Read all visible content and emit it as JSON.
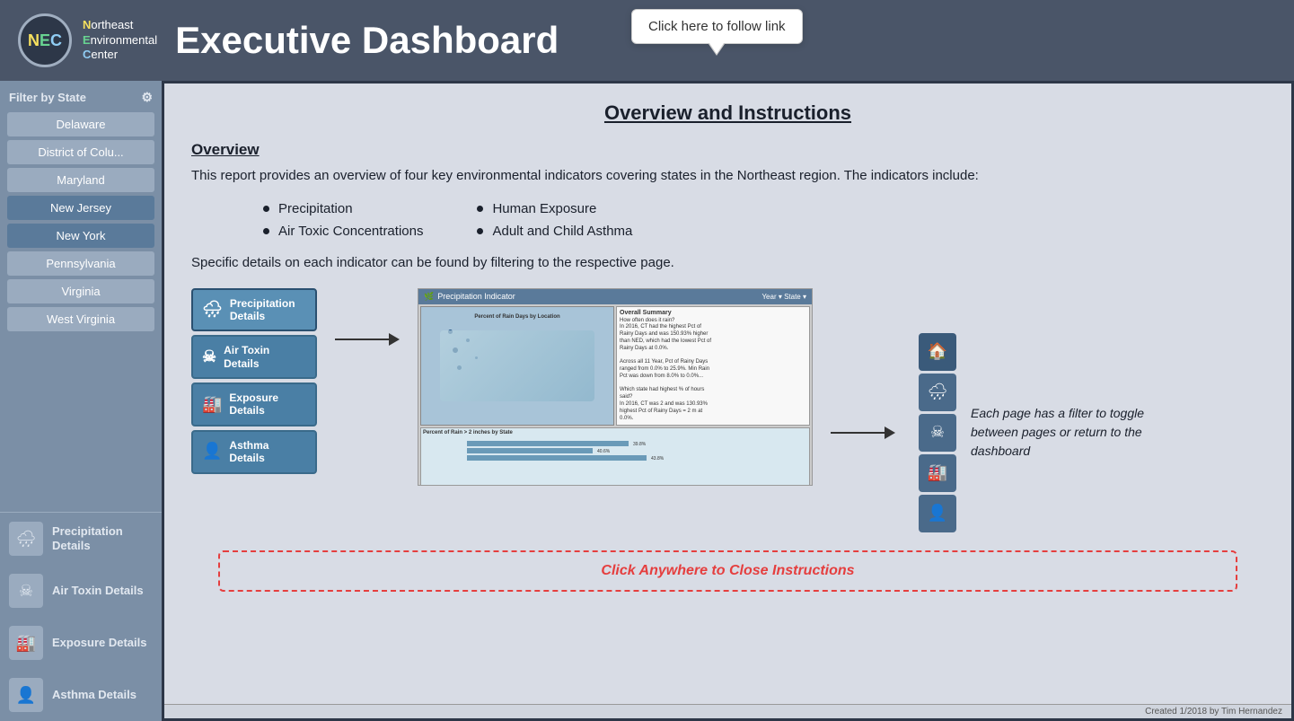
{
  "header": {
    "logo_letters": "NEC",
    "org_line1": "Northeast",
    "org_line2": "Environmental",
    "org_line3": "Center",
    "title": "Executive Dashboard"
  },
  "tooltip": {
    "label": "Click here to follow link"
  },
  "sidebar": {
    "filter_label": "Filter by State",
    "states": [
      {
        "label": "Delaware"
      },
      {
        "label": "District of Colu..."
      },
      {
        "label": "Maryland"
      },
      {
        "label": "New Jersey"
      },
      {
        "label": "New York"
      },
      {
        "label": "Pennsylvania"
      },
      {
        "label": "Virginia"
      },
      {
        "label": "West Virginia"
      }
    ],
    "nav_items": [
      {
        "label": "Precipitation Details",
        "icon": "🌧"
      },
      {
        "label": "Air Toxin Details",
        "icon": "☠"
      },
      {
        "label": "Exposure Details",
        "icon": "🏭"
      },
      {
        "label": "Asthma Details",
        "icon": "👤"
      }
    ]
  },
  "instructions": {
    "title": "Overview and Instructions",
    "overview_heading": "Overview",
    "overview_text": "This report provides an overview of four key environmental indicators covering states in the Northeast region.  The indicators include:",
    "bullets_left": [
      "Precipitation",
      "Air Toxic Concentrations"
    ],
    "bullets_right": [
      "Human Exposure",
      "Adult and Child Asthma"
    ],
    "specific_text": "Specific details on each indicator can be found by filtering to the respective page.",
    "menu_buttons": [
      {
        "label": "Precipitation Details",
        "icon": "🌧"
      },
      {
        "label": "Air Toxin Details",
        "icon": "☠"
      },
      {
        "label": "Exposure Details",
        "icon": "🏭"
      },
      {
        "label": "Asthma Details",
        "icon": "👤"
      }
    ],
    "preview_title": "Precipitation Indicator",
    "caption": "Each page has a filter to toggle between pages or return to the dashboard",
    "close_label": "Click Anywhere to Close Instructions"
  },
  "footer": {
    "text": "Created 1/2018 by Tim Hernandez"
  }
}
